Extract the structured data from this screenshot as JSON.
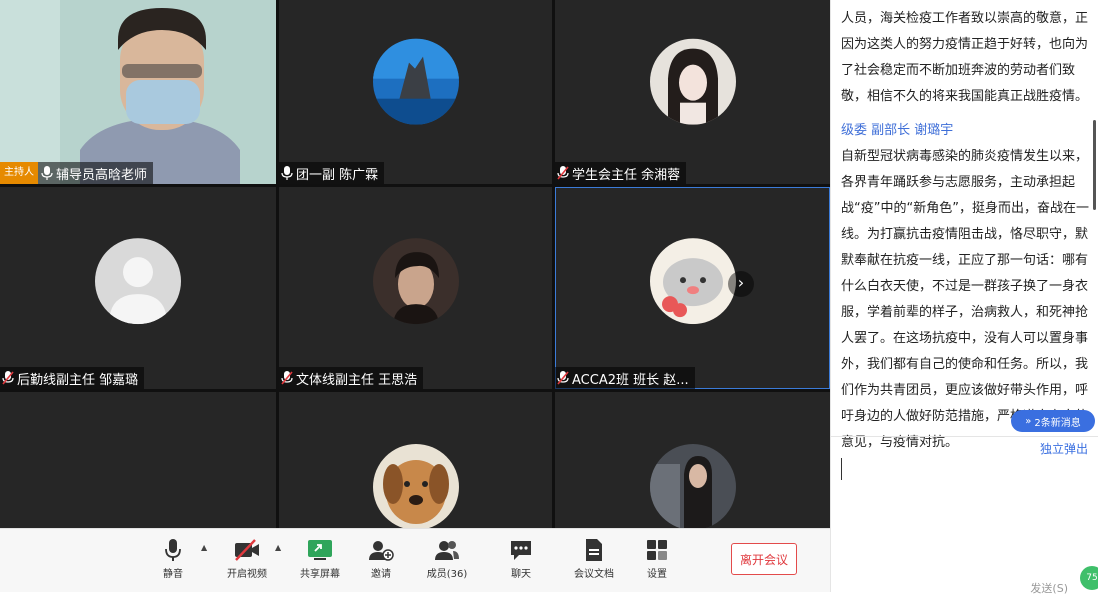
{
  "tiles": [
    {
      "name": "辅导员高晗老师",
      "host_badge": "主持人",
      "mic": "on"
    },
    {
      "name": "团一副 陈广霖",
      "mic": "on"
    },
    {
      "name": "学生会主任 余湘蓉",
      "mic": "muted"
    },
    {
      "name": "后勤线副主任 邹嘉璐",
      "mic": "muted"
    },
    {
      "name": "文体线副主任 王思浩",
      "mic": "muted"
    },
    {
      "name": "ACCA2班 班长 赵...",
      "mic": "muted"
    },
    {
      "name": "",
      "mic": ""
    },
    {
      "name": "",
      "mic": ""
    },
    {
      "name": "",
      "mic": ""
    }
  ],
  "toolbar": {
    "mute": "静音",
    "video": "开启视频",
    "share": "共享屏幕",
    "invite": "邀请",
    "members": "成员(36)",
    "chat": "聊天",
    "docs": "会议文档",
    "settings": "设置",
    "leave": "离开会议"
  },
  "chat": {
    "msg1_text": "人员，海关检疫工作者致以崇高的敬意，正因为这类人的努力疫情正趋于好转，也向为了社会稳定而不断加班奔波的劳动者们致敬，相信不久的将来我国能真正战胜疫情。",
    "msg2_sender": "级委 副部长 谢璐宇",
    "msg2_text": "自新型冠状病毒感染的肺炎疫情发生以来，各界青年踊跃参与志愿服务，主动承担起战“疫”中的“新角色”，挺身而出，奋战在一线。为打赢抗击疫情阻击战，恪尽职守，默默奉献在抗疫一线，正应了那一句话：哪有什么白衣天使，不过是一群孩子换了一身衣服，学着前辈的样子，治病救人，和死神抢人罢了。在这场抗疫中，没有人可以置身事外，我们都有自己的使命和任务。所以，我们作为共青团员，更应该做好带头作用，呼吁身边的人做好防范措施，严格遵守专家的意见，与疫情对抗。",
    "new_messages": "2条新消息",
    "popout": "独立弹出",
    "send": "发送(S)",
    "badge": "75"
  },
  "colors": {
    "accent": "#3a6fe0",
    "leave": "#e0393e",
    "host_badge": "#e68a00"
  }
}
